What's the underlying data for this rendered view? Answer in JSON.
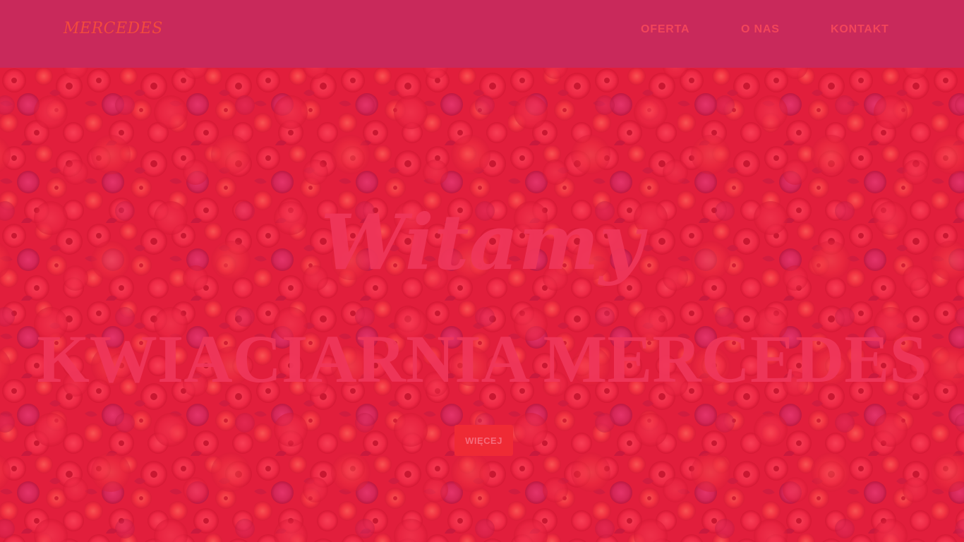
{
  "header": {
    "logo": "MERCEDES",
    "nav": [
      {
        "label": "OFERTA"
      },
      {
        "label": "O NAS"
      },
      {
        "label": "KONTAKT"
      }
    ]
  },
  "hero": {
    "background": "flowers-wall-image",
    "headline": "Witamy",
    "subheadline": "KWIACIARNIA MERCEDES",
    "button_label": "WIĘCEJ"
  },
  "colors": {
    "header_bg": "#c9295b",
    "hero_tint": "#e8213e",
    "accent": "#f2455a",
    "button_bg": "#ef2a35"
  }
}
